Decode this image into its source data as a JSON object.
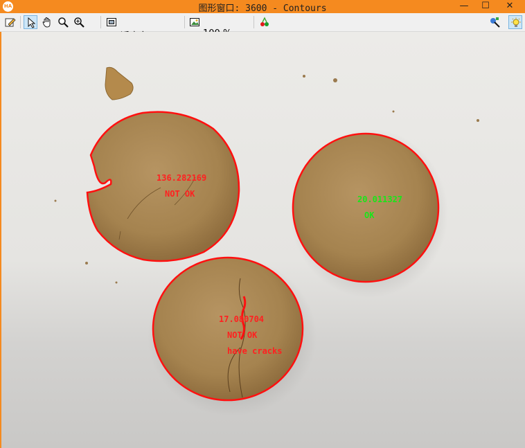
{
  "window": {
    "title": "图形窗口: 3600 - Contours",
    "app_badge": "HA",
    "minimize_glyph": "—",
    "maximize_glyph": "☐",
    "close_glyph": "✕"
  },
  "toolbar": {
    "zoom_mode": "适应窗口",
    "zoom_percent": "100 %",
    "icons": [
      "edit-icon",
      "pointer-icon",
      "hand-icon",
      "magnifier-icon",
      "zoom-in-icon",
      "fit-window-icon",
      "image-zoom-icon",
      "color-icon",
      "visualization-icon",
      "lightbulb-icon"
    ]
  },
  "colors": {
    "contour": "#ff1010",
    "ok": "#19e619",
    "not_ok": "#ff2020"
  },
  "image": {
    "cookies": [
      {
        "value": "136.282169",
        "status": "NOT OK",
        "note": ""
      },
      {
        "value": "20.011327",
        "status": "OK",
        "note": ""
      },
      {
        "value": "17.080704",
        "status": "NOT OK",
        "note": "have cracks"
      }
    ]
  }
}
